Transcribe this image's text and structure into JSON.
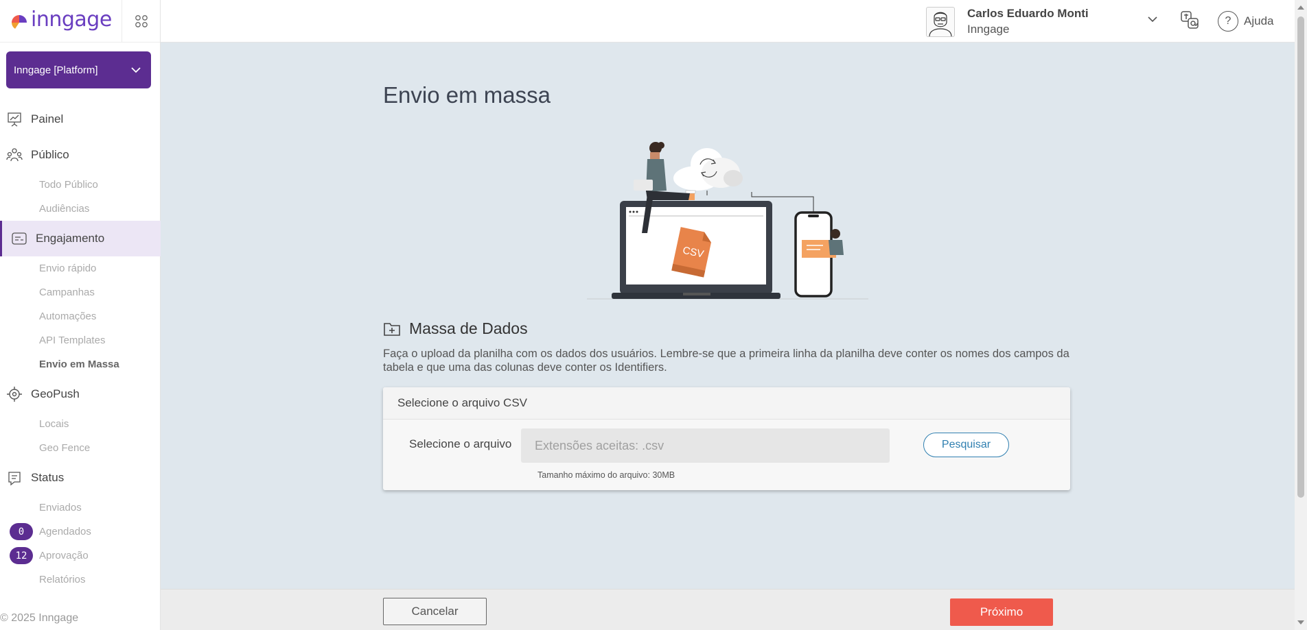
{
  "brand": {
    "logo_text": "inngage",
    "purple": "#5c2d91",
    "logo_colors": [
      "#ef5a4c",
      "#f0a030",
      "#6a3ec0"
    ]
  },
  "org_select": {
    "value": "Inngage [Platform]"
  },
  "nav": {
    "painel": "Painel",
    "publico": {
      "label": "Público",
      "items": [
        "Todo Público",
        "Audiências"
      ]
    },
    "engajamento": {
      "label": "Engajamento",
      "items": [
        "Envio rápido",
        "Campanhas",
        "Automações",
        "API Templates",
        "Envio em Massa"
      ]
    },
    "geopush": {
      "label": "GeoPush",
      "items": [
        "Locais",
        "Geo Fence"
      ]
    },
    "status": {
      "label": "Status",
      "items": [
        "Enviados",
        "Agendados",
        "Aprovação",
        "Relatórios"
      ],
      "badges": {
        "agendados": "0",
        "aprovacao": "12"
      }
    }
  },
  "copyright": "© 2025 Inngage",
  "header": {
    "user_name": "Carlos Eduardo Monti",
    "user_org": "Inngage",
    "help_label": "Ajuda",
    "help_symbol": "?"
  },
  "main": {
    "title": "Envio em massa",
    "illustration_text": "CSV",
    "section_title": "Massa de Dados",
    "description": "Faça o upload da planilha com os dados dos usuários. Lembre-se que a primeira linha da planilha deve conter os nomes dos campos da tabela e que uma das colunas deve conter os Identifiers.",
    "card": {
      "header": "Selecione o arquivo CSV",
      "file_label": "Selecione o arquivo",
      "file_placeholder": "Extensões aceitas: .csv",
      "search_button": "Pesquisar",
      "max_size": "Tamanho máximo do arquivo: 30MB"
    }
  },
  "footer": {
    "cancel": "Cancelar",
    "next": "Próximo"
  }
}
